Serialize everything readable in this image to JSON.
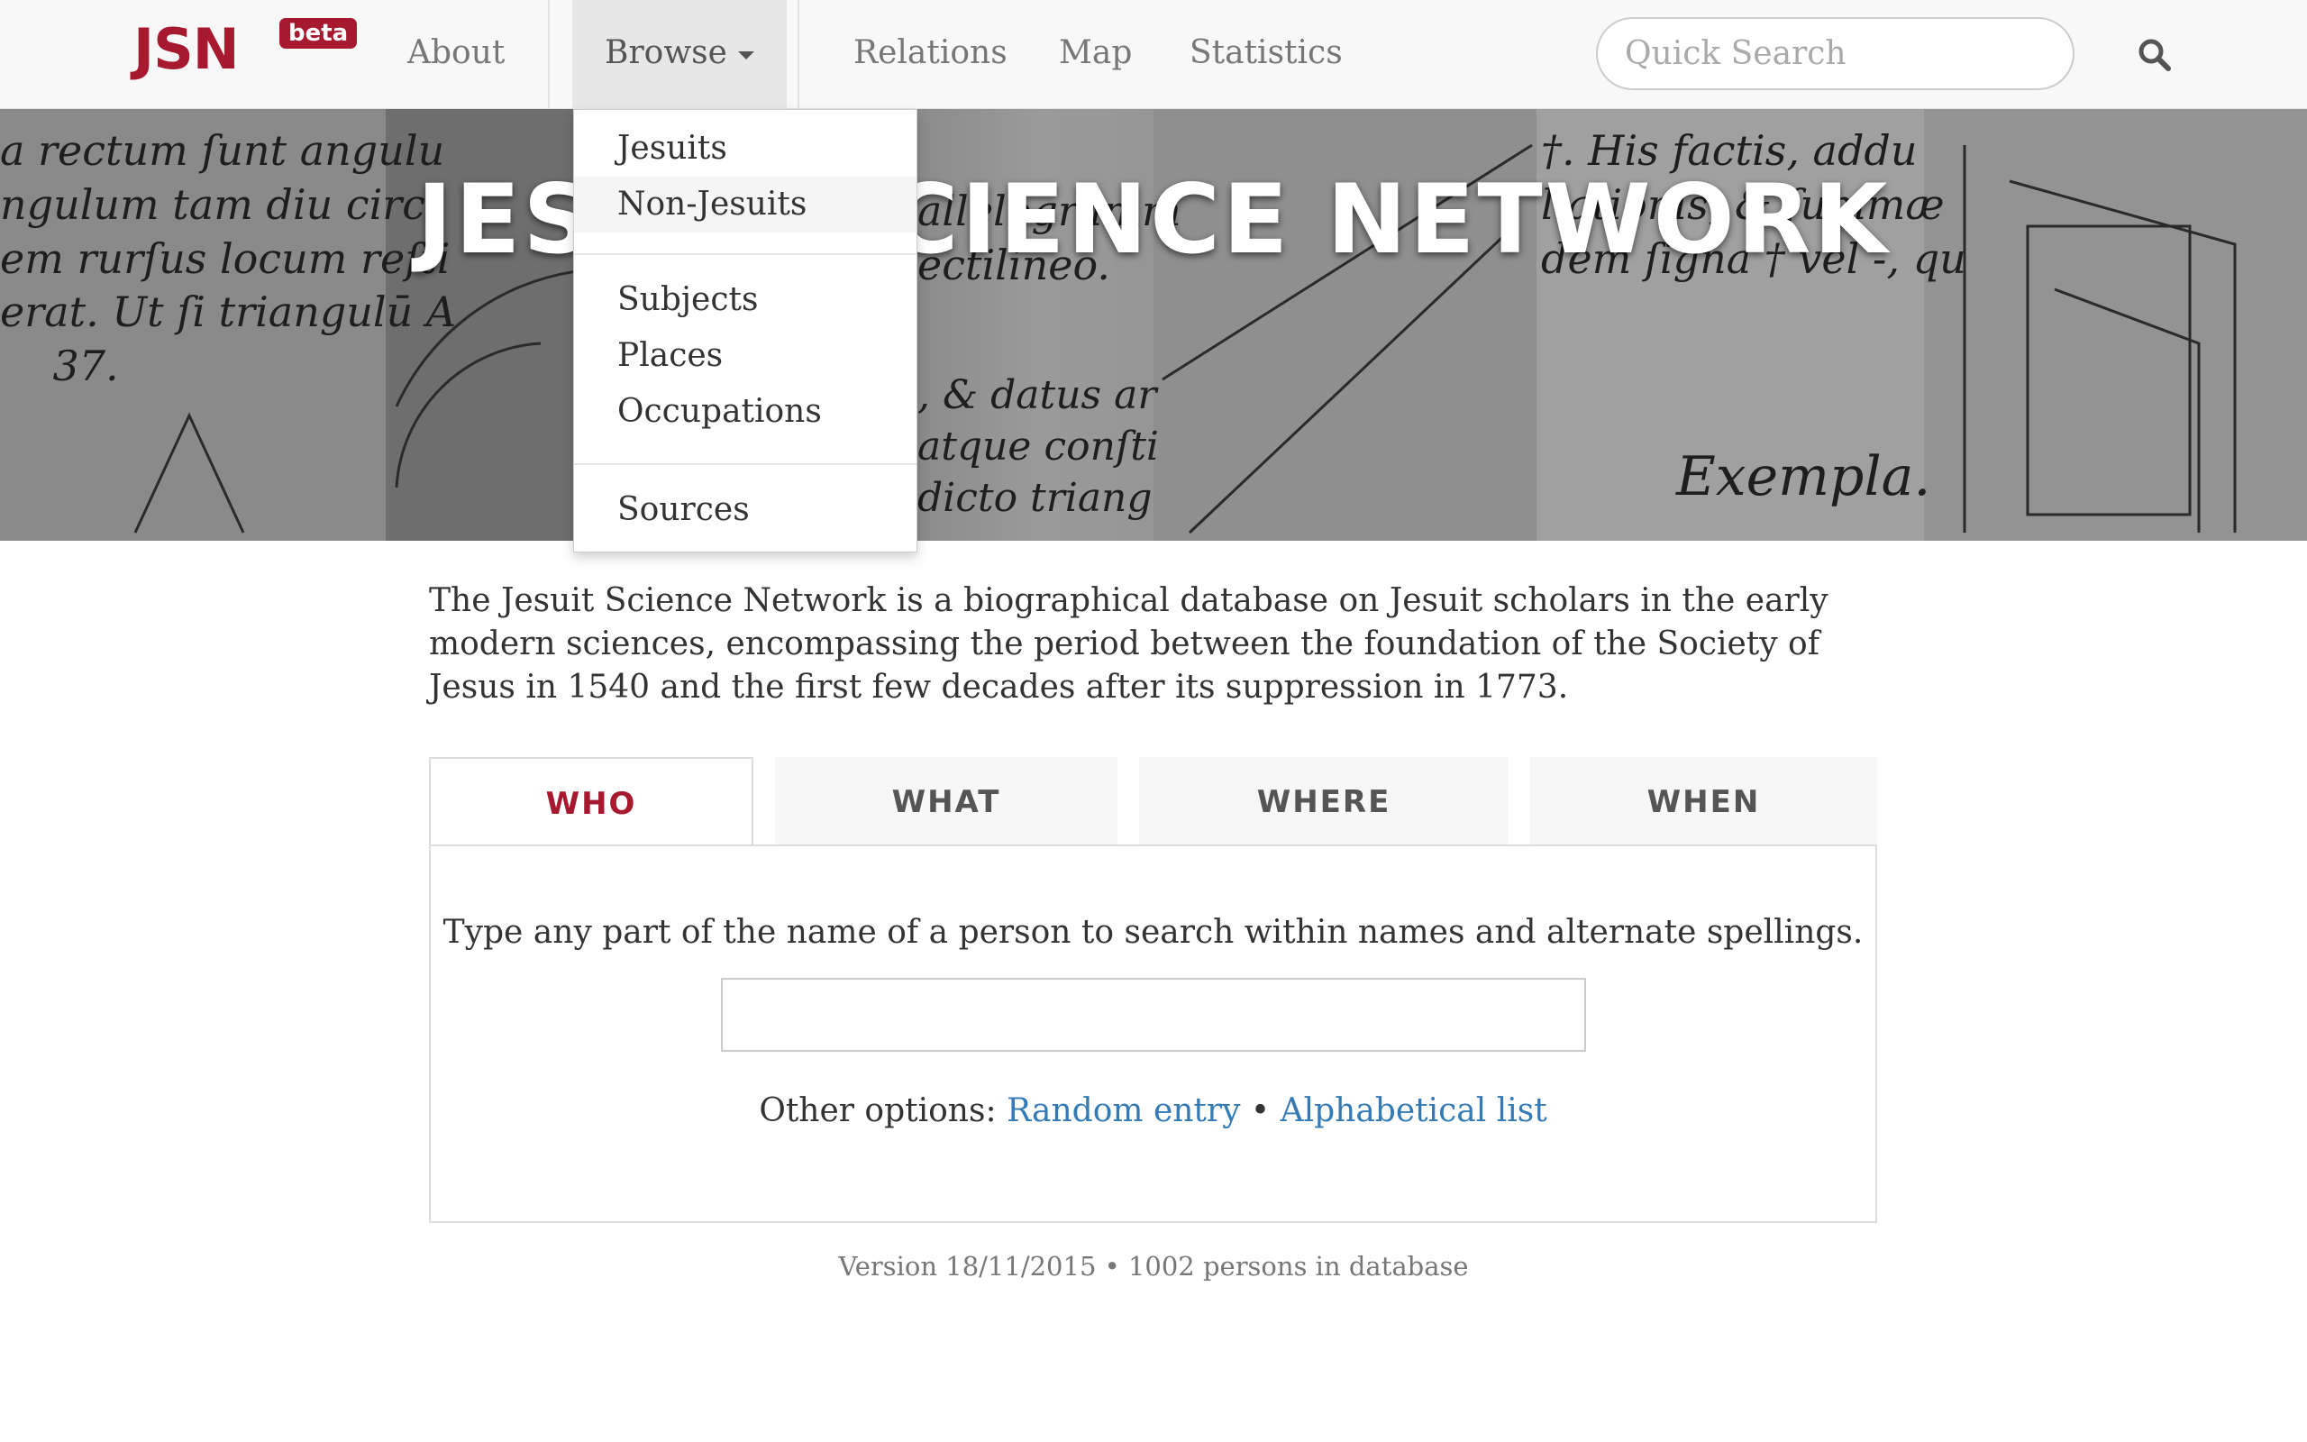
{
  "brand": {
    "name": "JSN",
    "badge": "beta",
    "color": "#a6192e"
  },
  "nav": {
    "about": "About",
    "browse": "Browse",
    "relations": "Relations",
    "map": "Map",
    "statistics": "Statistics"
  },
  "quick_search": {
    "placeholder": "Quick Search",
    "icon": "search-icon"
  },
  "browse_menu": {
    "jesuits": "Jesuits",
    "non_jesuits": "Non-Jesuits",
    "subjects": "Subjects",
    "places": "Places",
    "occupations": "Occupations",
    "sources": "Sources"
  },
  "hero": {
    "title": "JESUIT SCIENCE NETWORK"
  },
  "intro": "The Jesuit Science Network is a biographical database on Jesuit scholars in the early modern sciences, encompassing the period between the foundation of the Society of Jesus in 1540 and the first few decades after its suppression in 1773.",
  "tabs": {
    "who": "WHO",
    "what": "WHAT",
    "where": "WHERE",
    "when": "WHEN"
  },
  "who_panel": {
    "hint": "Type any part of the name of a person to search within names and alternate spellings.",
    "input_value": "",
    "other_options_label": "Other options:",
    "random_entry": "Random entry",
    "separator": "•",
    "alphabetical_list": "Alphabetical list"
  },
  "footer": {
    "version": "Version 18/11/2015 • 1002 persons in database"
  },
  "colors": {
    "accent": "#a6192e",
    "link": "#337ab7",
    "nav_text": "#777777"
  }
}
